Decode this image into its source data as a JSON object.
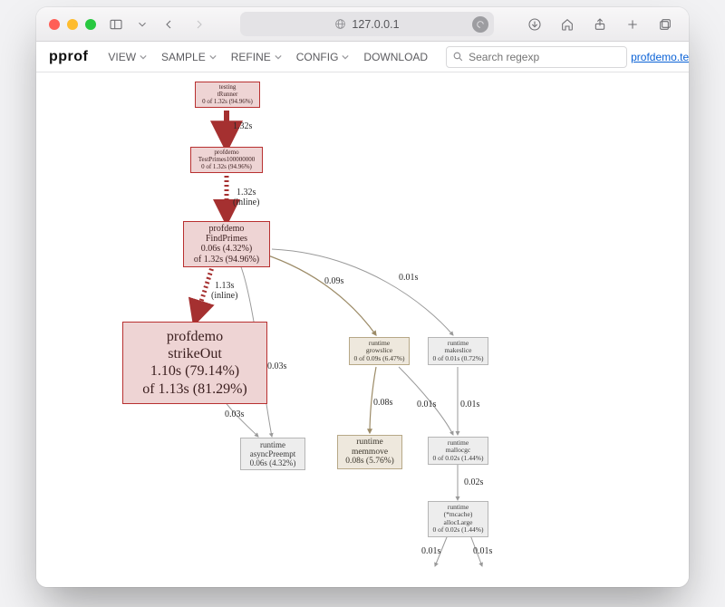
{
  "browser": {
    "address": "127.0.0.1"
  },
  "app": {
    "brand": "pprof",
    "menus": {
      "view": "VIEW",
      "sample": "SAMPLE",
      "refine": "REFINE",
      "config": "CONFIG",
      "download": "DOWNLOAD"
    },
    "search_placeholder": "Search regexp",
    "profile_name": "profdemo.test.cpu"
  },
  "nodes": {
    "tRunner": {
      "l1": "testing",
      "l2": "tRunner",
      "l3": "0 of 1.32s (94.96%)"
    },
    "testPrimes": {
      "l1": "profdemo",
      "l2": "TestPrimes100000000",
      "l3": "0 of 1.32s (94.96%)"
    },
    "findPrimes": {
      "l1": "profdemo",
      "l2": "FindPrimes",
      "l3": "0.06s (4.32%)",
      "l4": "of 1.32s (94.96%)"
    },
    "strikeOut": {
      "l1": "profdemo",
      "l2": "strikeOut",
      "l3": "1.10s (79.14%)",
      "l4": "of 1.13s (81.29%)"
    },
    "growslice": {
      "l1": "runtime",
      "l2": "growslice",
      "l3": "0 of 0.09s (6.47%)"
    },
    "makeslice": {
      "l1": "runtime",
      "l2": "makeslice",
      "l3": "0 of 0.01s (0.72%)"
    },
    "asyncPreempt": {
      "l1": "runtime",
      "l2": "asyncPreempt",
      "l3": "0.06s (4.32%)"
    },
    "memmove": {
      "l1": "runtime",
      "l2": "memmove",
      "l3": "0.08s (5.76%)"
    },
    "mallocgc": {
      "l1": "runtime",
      "l2": "mallocgc",
      "l3": "0 of 0.02s (1.44%)"
    },
    "alloclarge": {
      "l1": "runtime",
      "l2": "(*mcache)",
      "l3": "allocLarge",
      "l4": "0 of 0.02s (1.44%)"
    }
  },
  "edges": {
    "e1": "1.32s",
    "e2_a": "1.32s",
    "e2_b": "(inline)",
    "e3_a": "1.13s",
    "e3_b": "(inline)",
    "e4": "0.03s",
    "e5": "0.09s",
    "e6": "0.01s",
    "e7": "0.03s",
    "e8": "0.08s",
    "e9": "0.01s",
    "e10": "0.01s",
    "e11": "0.02s",
    "e12": "0.01s",
    "e13": "0.01s"
  }
}
